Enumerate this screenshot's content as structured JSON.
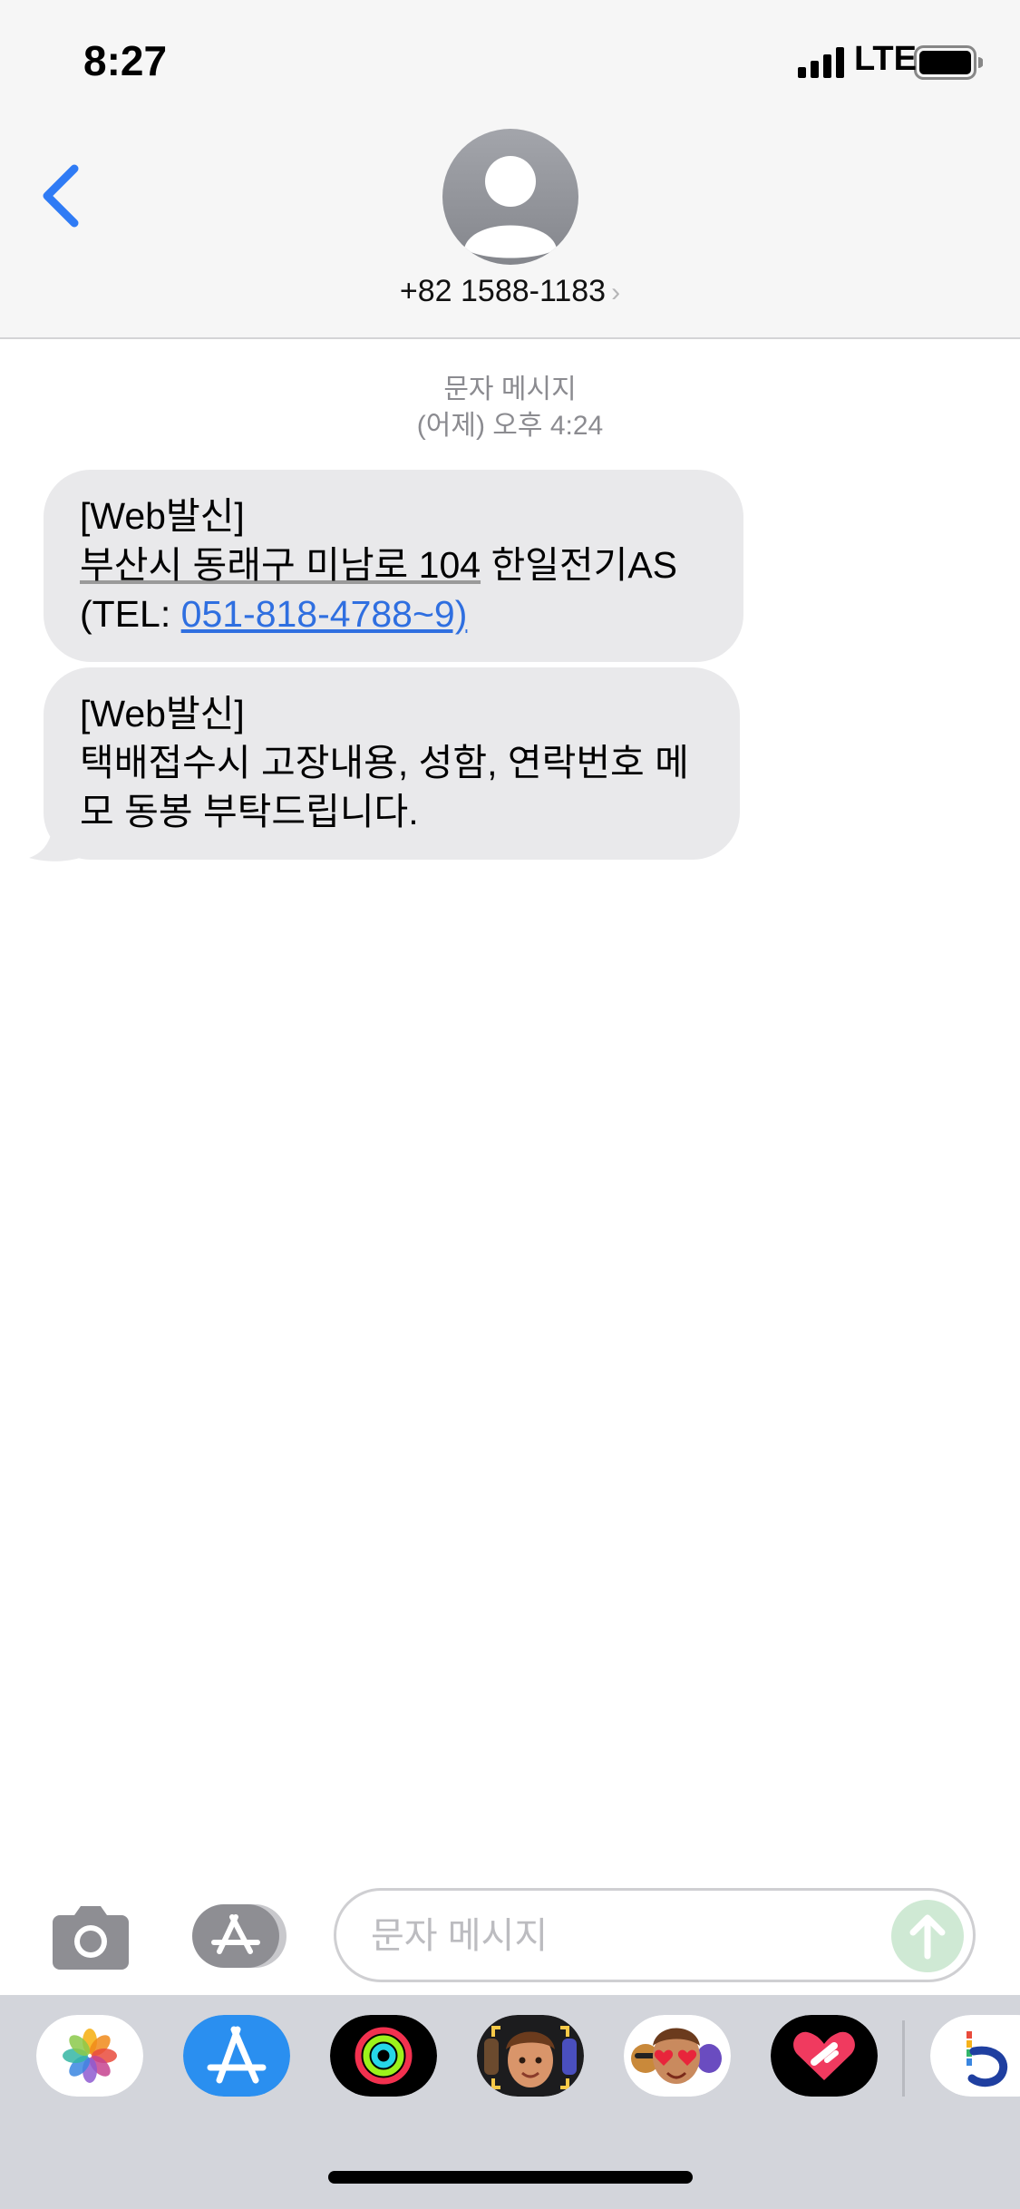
{
  "status_bar": {
    "time": "8:27",
    "network": "LTE",
    "signal_icon": "cellular-signal-icon",
    "battery_icon": "battery-icon"
  },
  "header": {
    "back_icon": "chevron-left-icon",
    "avatar_icon": "person-silhouette-icon",
    "contact": "+82 1588-1183",
    "contact_chevron": "›"
  },
  "thread": {
    "service_label": "문자 메시지",
    "timestamp": "(어제) 오후 4:24",
    "messages": [
      {
        "line1": "[Web발신]",
        "address": "부산시 동래구 미남로 104",
        "address_suffix": " 한일전기AS",
        "tel_prefix": "(TEL: ",
        "tel_link": "051-818-4788~9)"
      },
      {
        "line1": "[Web발신]",
        "line2": "택배접수시 고장내용, 성함, 연락번호 메",
        "line3": "모 동봉 부탁드립니다."
      }
    ]
  },
  "composer": {
    "camera_icon": "camera-icon",
    "apps_icon": "app-store-icon",
    "placeholder": "문자 메시지",
    "value": "",
    "send_icon": "arrow-up-icon"
  },
  "app_drawer": {
    "apps": [
      "photos-icon",
      "app-store-icon",
      "activity-icon",
      "memoji-icon",
      "animoji-stickers-icon",
      "digital-touch-icon",
      "music-app-icon"
    ]
  },
  "colors": {
    "header_bg": "#f6f6f6",
    "bubble_bg": "#e9e9eb",
    "link": "#2f6fe0",
    "accent": "#2f7bf5",
    "drawer_bg": "#d3d5db"
  }
}
